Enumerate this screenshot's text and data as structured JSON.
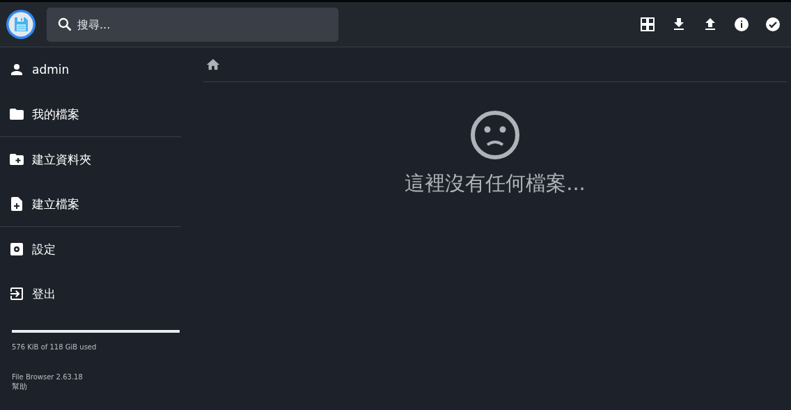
{
  "header": {
    "search": {
      "placeholder": "搜尋..."
    },
    "actions": [
      {
        "kind": "grid"
      },
      {
        "kind": "download"
      },
      {
        "kind": "upload"
      },
      {
        "kind": "info"
      },
      {
        "kind": "check"
      }
    ]
  },
  "sidebar": {
    "groups": [
      [
        {
          "kind": "user",
          "label": "admin"
        },
        {
          "kind": "folder",
          "label": "我的檔案"
        }
      ],
      [
        {
          "kind": "new-folder",
          "label": "建立資料夾"
        },
        {
          "kind": "new-file",
          "label": "建立檔案"
        }
      ],
      [
        {
          "kind": "settings",
          "label": "設定"
        },
        {
          "kind": "logout",
          "label": "登出"
        }
      ]
    ],
    "usage": {
      "level": 0.0,
      "text": "576 KiB of 118 GiB used"
    },
    "version": "File Browser 2.63.18",
    "help": "幫助"
  },
  "content": {
    "empty_message": "這裡沒有任何檔案..."
  }
}
